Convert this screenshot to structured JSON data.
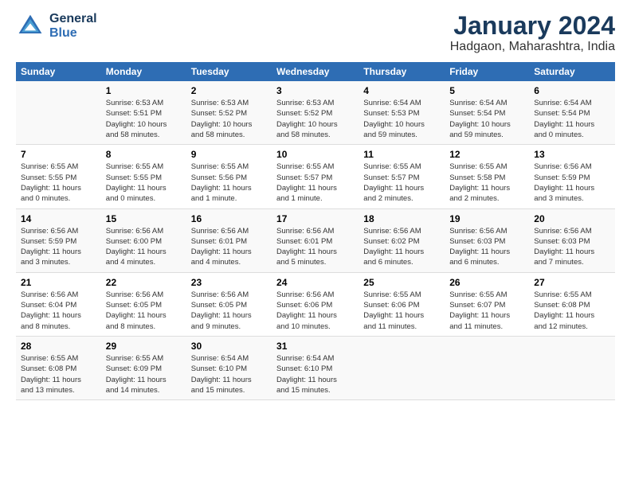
{
  "header": {
    "logo_line1": "General",
    "logo_line2": "Blue",
    "title": "January 2024",
    "location": "Hadgaon, Maharashtra, India"
  },
  "days_of_week": [
    "Sunday",
    "Monday",
    "Tuesday",
    "Wednesday",
    "Thursday",
    "Friday",
    "Saturday"
  ],
  "weeks": [
    [
      {
        "day": "",
        "info": ""
      },
      {
        "day": "1",
        "info": "Sunrise: 6:53 AM\nSunset: 5:51 PM\nDaylight: 10 hours\nand 58 minutes."
      },
      {
        "day": "2",
        "info": "Sunrise: 6:53 AM\nSunset: 5:52 PM\nDaylight: 10 hours\nand 58 minutes."
      },
      {
        "day": "3",
        "info": "Sunrise: 6:53 AM\nSunset: 5:52 PM\nDaylight: 10 hours\nand 58 minutes."
      },
      {
        "day": "4",
        "info": "Sunrise: 6:54 AM\nSunset: 5:53 PM\nDaylight: 10 hours\nand 59 minutes."
      },
      {
        "day": "5",
        "info": "Sunrise: 6:54 AM\nSunset: 5:54 PM\nDaylight: 10 hours\nand 59 minutes."
      },
      {
        "day": "6",
        "info": "Sunrise: 6:54 AM\nSunset: 5:54 PM\nDaylight: 11 hours\nand 0 minutes."
      }
    ],
    [
      {
        "day": "7",
        "info": "Sunrise: 6:55 AM\nSunset: 5:55 PM\nDaylight: 11 hours\nand 0 minutes."
      },
      {
        "day": "8",
        "info": "Sunrise: 6:55 AM\nSunset: 5:55 PM\nDaylight: 11 hours\nand 0 minutes."
      },
      {
        "day": "9",
        "info": "Sunrise: 6:55 AM\nSunset: 5:56 PM\nDaylight: 11 hours\nand 1 minute."
      },
      {
        "day": "10",
        "info": "Sunrise: 6:55 AM\nSunset: 5:57 PM\nDaylight: 11 hours\nand 1 minute."
      },
      {
        "day": "11",
        "info": "Sunrise: 6:55 AM\nSunset: 5:57 PM\nDaylight: 11 hours\nand 2 minutes."
      },
      {
        "day": "12",
        "info": "Sunrise: 6:55 AM\nSunset: 5:58 PM\nDaylight: 11 hours\nand 2 minutes."
      },
      {
        "day": "13",
        "info": "Sunrise: 6:56 AM\nSunset: 5:59 PM\nDaylight: 11 hours\nand 3 minutes."
      }
    ],
    [
      {
        "day": "14",
        "info": "Sunrise: 6:56 AM\nSunset: 5:59 PM\nDaylight: 11 hours\nand 3 minutes."
      },
      {
        "day": "15",
        "info": "Sunrise: 6:56 AM\nSunset: 6:00 PM\nDaylight: 11 hours\nand 4 minutes."
      },
      {
        "day": "16",
        "info": "Sunrise: 6:56 AM\nSunset: 6:01 PM\nDaylight: 11 hours\nand 4 minutes."
      },
      {
        "day": "17",
        "info": "Sunrise: 6:56 AM\nSunset: 6:01 PM\nDaylight: 11 hours\nand 5 minutes."
      },
      {
        "day": "18",
        "info": "Sunrise: 6:56 AM\nSunset: 6:02 PM\nDaylight: 11 hours\nand 6 minutes."
      },
      {
        "day": "19",
        "info": "Sunrise: 6:56 AM\nSunset: 6:03 PM\nDaylight: 11 hours\nand 6 minutes."
      },
      {
        "day": "20",
        "info": "Sunrise: 6:56 AM\nSunset: 6:03 PM\nDaylight: 11 hours\nand 7 minutes."
      }
    ],
    [
      {
        "day": "21",
        "info": "Sunrise: 6:56 AM\nSunset: 6:04 PM\nDaylight: 11 hours\nand 8 minutes."
      },
      {
        "day": "22",
        "info": "Sunrise: 6:56 AM\nSunset: 6:05 PM\nDaylight: 11 hours\nand 8 minutes."
      },
      {
        "day": "23",
        "info": "Sunrise: 6:56 AM\nSunset: 6:05 PM\nDaylight: 11 hours\nand 9 minutes."
      },
      {
        "day": "24",
        "info": "Sunrise: 6:56 AM\nSunset: 6:06 PM\nDaylight: 11 hours\nand 10 minutes."
      },
      {
        "day": "25",
        "info": "Sunrise: 6:55 AM\nSunset: 6:06 PM\nDaylight: 11 hours\nand 11 minutes."
      },
      {
        "day": "26",
        "info": "Sunrise: 6:55 AM\nSunset: 6:07 PM\nDaylight: 11 hours\nand 11 minutes."
      },
      {
        "day": "27",
        "info": "Sunrise: 6:55 AM\nSunset: 6:08 PM\nDaylight: 11 hours\nand 12 minutes."
      }
    ],
    [
      {
        "day": "28",
        "info": "Sunrise: 6:55 AM\nSunset: 6:08 PM\nDaylight: 11 hours\nand 13 minutes."
      },
      {
        "day": "29",
        "info": "Sunrise: 6:55 AM\nSunset: 6:09 PM\nDaylight: 11 hours\nand 14 minutes."
      },
      {
        "day": "30",
        "info": "Sunrise: 6:54 AM\nSunset: 6:10 PM\nDaylight: 11 hours\nand 15 minutes."
      },
      {
        "day": "31",
        "info": "Sunrise: 6:54 AM\nSunset: 6:10 PM\nDaylight: 11 hours\nand 15 minutes."
      },
      {
        "day": "",
        "info": ""
      },
      {
        "day": "",
        "info": ""
      },
      {
        "day": "",
        "info": ""
      }
    ]
  ]
}
